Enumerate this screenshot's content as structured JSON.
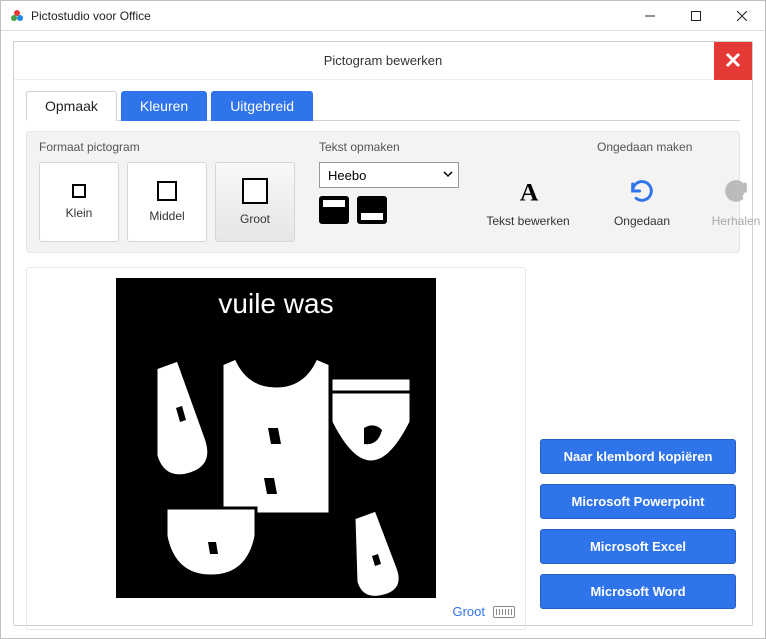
{
  "window": {
    "title": "Pictostudio voor Office"
  },
  "panel": {
    "title": "Pictogram bewerken"
  },
  "tabs": {
    "opmaak": "Opmaak",
    "kleuren": "Kleuren",
    "uitgebreid": "Uitgebreid"
  },
  "groups": {
    "size_title": "Formaat pictogram",
    "text_title": "Tekst opmaken",
    "undo_title": "Ongedaan maken"
  },
  "sizes": {
    "small": "Klein",
    "medium": "Middel",
    "large": "Groot"
  },
  "font": {
    "selected": "Heebo"
  },
  "actions": {
    "text_edit": "Tekst bewerken",
    "undo": "Ongedaan",
    "redo": "Herhalen"
  },
  "picto": {
    "caption": "vuile was",
    "size_label": "Groot"
  },
  "export": {
    "clipboard": "Naar klembord kopiëren",
    "powerpoint": "Microsoft Powerpoint",
    "excel": "Microsoft Excel",
    "word": "Microsoft Word"
  }
}
